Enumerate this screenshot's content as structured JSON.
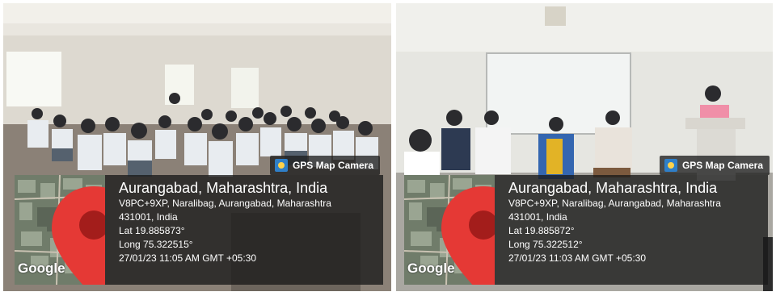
{
  "photos": [
    {
      "badge_label": "GPS Map Camera",
      "city": "Aurangabad, Maharashtra, India",
      "address_line1": "V8PC+9XP, Naralibag, Aurangabad, Maharashtra",
      "address_line2": "431001, India",
      "lat": "Lat 19.885873°",
      "long": "Long 75.322515°",
      "datetime": "27/01/23 11:05 AM GMT +05:30",
      "map_brand": "Google"
    },
    {
      "badge_label": "GPS Map Camera",
      "city": "Aurangabad, Maharashtra, India",
      "address_line1": "V8PC+9XP, Naralibag, Aurangabad, Maharashtra",
      "address_line2": "431001, India",
      "lat": "Lat 19.885872°",
      "long": "Long 75.322512°",
      "datetime": "27/01/23 11:03 AM GMT +05:30",
      "map_brand": "Google"
    }
  ],
  "colors": {
    "pin": "#e53935",
    "overlay": "#1e1e1e"
  }
}
